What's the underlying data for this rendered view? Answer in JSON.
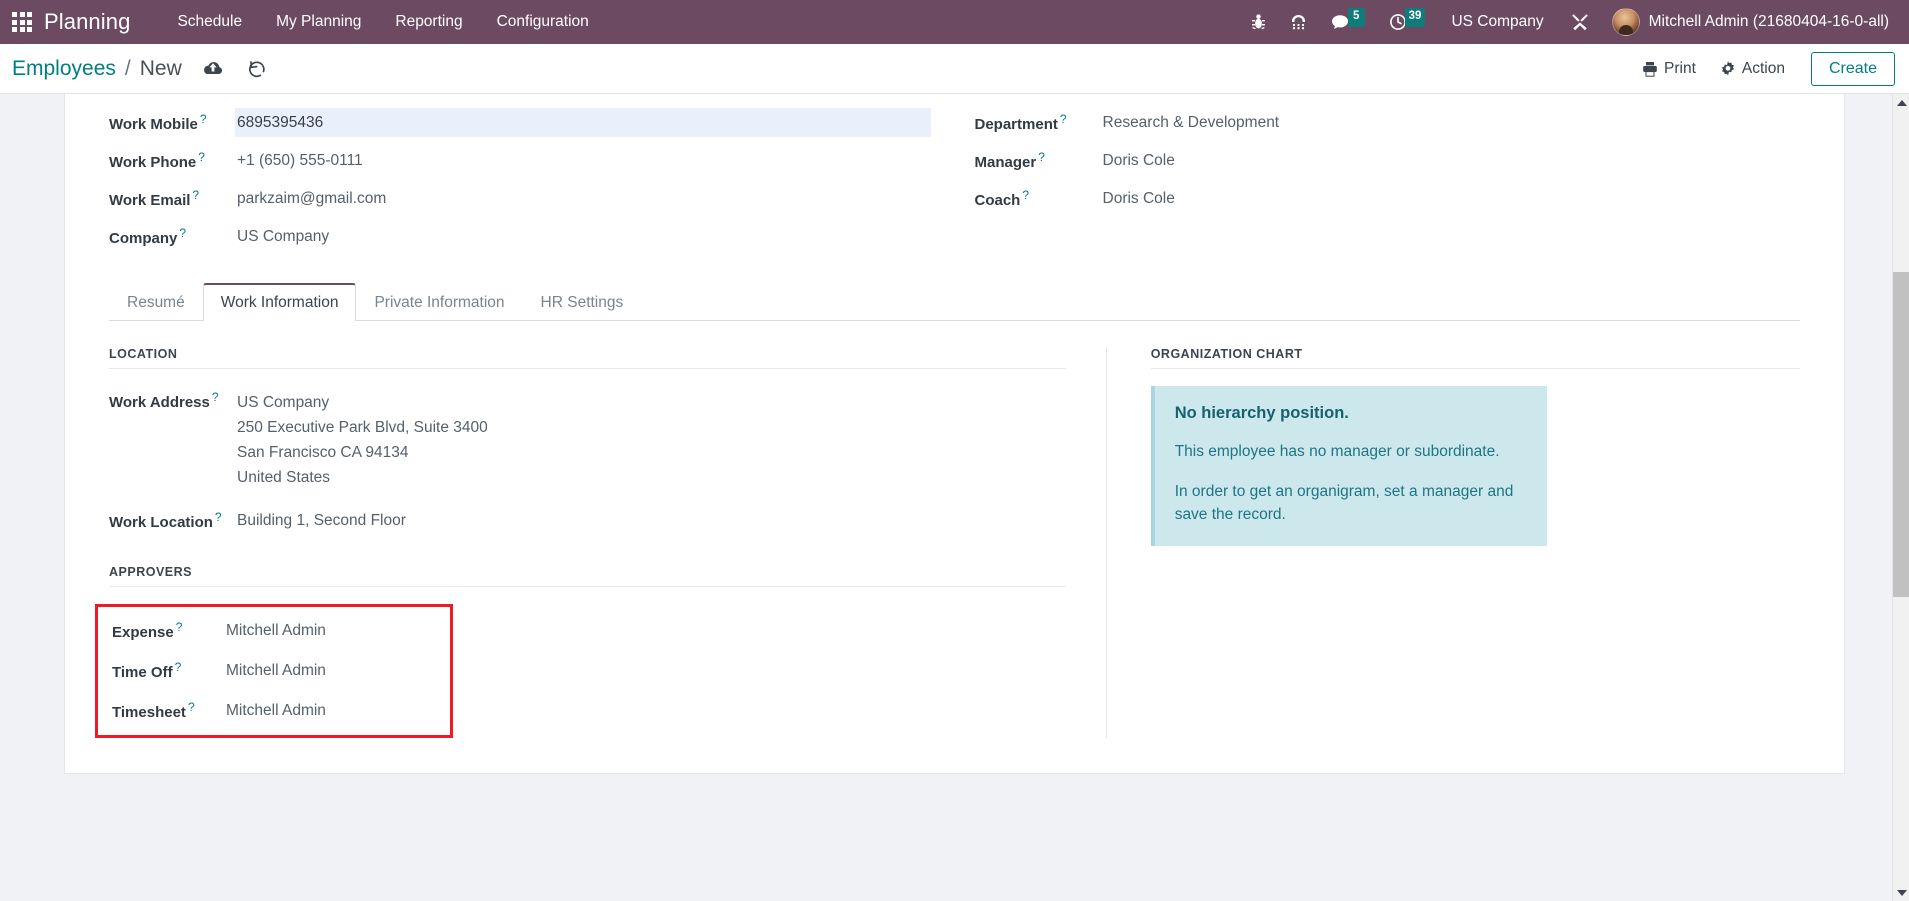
{
  "navbar": {
    "apps_icon": "apps-grid-icon",
    "brand": "Planning",
    "menu": [
      {
        "label": "Schedule"
      },
      {
        "label": "My Planning"
      },
      {
        "label": "Reporting"
      },
      {
        "label": "Configuration"
      }
    ],
    "icons": [
      {
        "name": "bug-icon",
        "glyph": "#"
      },
      {
        "name": "phone-keypad-icon",
        "glyph": "#"
      }
    ],
    "messages": {
      "icon": "messages-icon",
      "count": "5"
    },
    "activities": {
      "icon": "clock-icon",
      "count": "39"
    },
    "company": "US Company",
    "debug_icon": "debug-tools-icon",
    "user": "Mitchell Admin (21680404-16-0-all)"
  },
  "control_panel": {
    "breadcrumb_parent": "Employees",
    "breadcrumb_separator": "/",
    "breadcrumb_current": "New",
    "save_icon": "cloud-upload-save-icon",
    "discard_icon": "discard-undo-icon",
    "print_label": "Print",
    "print_icon": "printer-icon",
    "action_label": "Action",
    "action_icon": "gear-icon",
    "create_label": "Create",
    "accent_color": "#017e84"
  },
  "form": {
    "left_fields": [
      {
        "label": "Work Mobile",
        "value": "6895395436",
        "focused": true
      },
      {
        "label": "Work Phone",
        "value": "+1 (650) 555-0111",
        "focused": false
      },
      {
        "label": "Work Email",
        "value": "parkzaim@gmail.com",
        "focused": false
      },
      {
        "label": "Company",
        "value": "US Company",
        "focused": false
      }
    ],
    "right_fields": [
      {
        "label": "Department",
        "value": "Research & Development"
      },
      {
        "label": "Manager",
        "value": "Doris Cole"
      },
      {
        "label": "Coach",
        "value": "Doris Cole"
      }
    ]
  },
  "tabs": [
    {
      "label": "Resumé",
      "active": false
    },
    {
      "label": "Work Information",
      "active": true
    },
    {
      "label": "Private Information",
      "active": false
    },
    {
      "label": "HR Settings",
      "active": false
    }
  ],
  "work_information": {
    "location_title": "LOCATION",
    "work_address_label": "Work Address",
    "work_address_lines": [
      "US Company",
      "250 Executive Park Blvd, Suite 3400",
      "San Francisco CA 94134",
      "United States"
    ],
    "work_location_label": "Work Location",
    "work_location_value": "Building 1, Second Floor",
    "approvers_title": "APPROVERS",
    "approvers": [
      {
        "label": "Expense",
        "value": "Mitchell Admin"
      },
      {
        "label": "Time Off",
        "value": "Mitchell Admin"
      },
      {
        "label": "Timesheet",
        "value": "Mitchell Admin"
      }
    ],
    "highlight_color": "#ee1b22"
  },
  "organization_chart": {
    "title": "ORGANIZATION CHART",
    "alert_title": "No hierarchy position.",
    "alert_paragraphs": [
      "This employee has no manager or subordinate.",
      "In order to get an organigram, set a manager and save the record."
    ],
    "alert_bg": "#cde8ec"
  },
  "scrollbar": {
    "up_icon": "scroll-up-arrow-icon",
    "down_icon": "scroll-down-arrow-icon",
    "thumb": "scrollbar-thumb"
  }
}
